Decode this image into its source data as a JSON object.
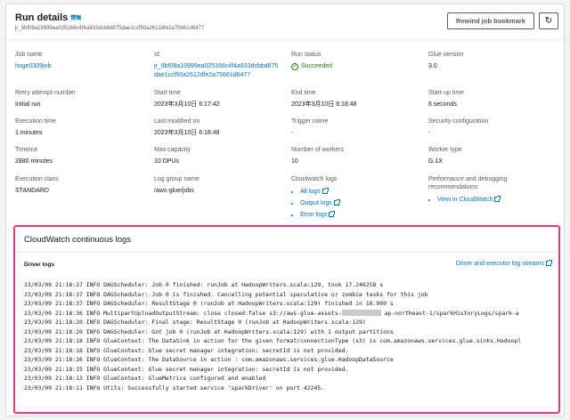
{
  "header": {
    "title": "Run details",
    "info": "情報",
    "run_id": "jr_9bf09a19999ea025166c4f4a933dcbbd875dae1ccf50a2612dfe2a75661d6477",
    "rewind_label": "Rewind job bookmark",
    "refresh_label": "↻"
  },
  "fields": {
    "job_name": {
      "label": "Job name",
      "value": "hoge0309job"
    },
    "id": {
      "label": "Id",
      "value_1": "jr_9bf09a19999ea025166c4f4a933dcbbd875",
      "value_2": "dae1ccf50a2612dfe2a75661d6477"
    },
    "run_status": {
      "label": "Run status",
      "value": "Succeeded"
    },
    "glue_version": {
      "label": "Glue version",
      "value": "3.0"
    },
    "retry": {
      "label": "Retry attempt number",
      "value": "Initial run"
    },
    "start_time": {
      "label": "Start time",
      "value": "2023年3月10日 6:17:42"
    },
    "end_time": {
      "label": "End time",
      "value": "2023年3月10日 6:18:48"
    },
    "startup_time": {
      "label": "Start-up time",
      "value": "6 seconds"
    },
    "execution_time": {
      "label": "Execution time",
      "value": "1 minutes"
    },
    "last_modified": {
      "label": "Last modified on",
      "value": "2023年3月10日 6:18:48"
    },
    "trigger_name": {
      "label": "Trigger name",
      "value": "-"
    },
    "security_config": {
      "label": "Security configuration",
      "value": "-"
    },
    "timeout": {
      "label": "Timeout",
      "value": "2880 minutes"
    },
    "max_capacity": {
      "label": "Max capacity",
      "value": "10 DPUs"
    },
    "workers": {
      "label": "Number of workers",
      "value": "10"
    },
    "worker_type": {
      "label": "Worker type",
      "value": "G.1X"
    },
    "execution_class": {
      "label": "Execution class",
      "value": "STANDARD"
    },
    "log_group": {
      "label": "Log group name",
      "value": "/aws-glue/jobs"
    },
    "cloudwatch_logs": {
      "label": "Cloudwatch logs",
      "items": [
        "All logs",
        "Output logs",
        "Error logs"
      ]
    },
    "perf_debug": {
      "label_1": "Performance and debugging",
      "label_2": "recommendations",
      "item": "View in CloudWatch"
    }
  },
  "cloudwatch": {
    "title": "CloudWatch continuous logs",
    "driver_label": "Driver logs",
    "executor_link": "Driver and executor log streams",
    "lines": [
      "23/03/09 21:18:37 INFO DAGScheduler: Job 0 finished: runJob at HadoopWriters.scala:129, took 17.246258 s",
      "23/03/09 21:18:37 INFO DAGScheduler: Job 0 is finished. Cancelling potential speculative or zombie tasks for this job",
      "23/03/09 21:18:37 INFO DAGScheduler: ResultStage 0 (runJob at HadoopWriters.scala:129) finished in 16.999 s",
      "23/03/09 21:18:36 INFO MultipartUploadOutputStream: close closed:false s3://aws-glue-assets-",
      "23/03/09 21:18:20 INFO DAGScheduler: Final stage: ResultStage 0 (runJob at HadoopWriters.scala:129)",
      "23/03/09 21:18:20 INFO DAGScheduler: Got job 0 (runJob at HadoopWriters.scala:129) with 1 output partitions",
      "23/03/09 21:18:18 INFO GlueContext: The DataSink in action for the given format/connectionType (s3) is com.amazonaws.services.glue.sinks.Hadoopl",
      "23/03/09 21:18:18 INFO GlueContext: Glue secret manager integration: secretId is not provided.",
      "23/03/09 21:18:16 INFO GlueContext: The DataSource in action : com.amazonaws.services.glue.HadoopDataSource",
      "23/03/09 21:18:15 INFO GlueContext: Glue secret manager integration: secretId is not provided.",
      "23/03/09 21:18:13 INFO GlueContext: GlueMetrics configured and enabled",
      "23/03/09 21:18:11 INFO Utils: Successfully started service 'sparkDriver' on port 42245."
    ],
    "line4_suffix": " ap-northeast-1/sparkHistoryLogs/spark-a"
  }
}
